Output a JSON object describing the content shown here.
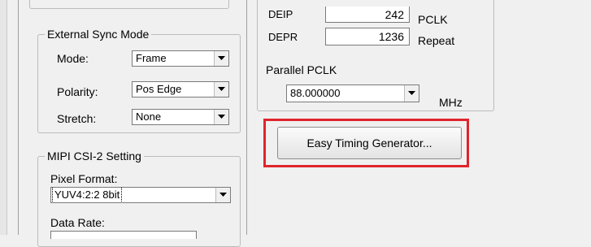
{
  "external_sync": {
    "title": "External Sync Mode",
    "mode_label": "Mode:",
    "mode_value": "Frame",
    "polarity_label": "Polarity:",
    "polarity_value": "Pos Edge",
    "stretch_label": "Stretch:",
    "stretch_value": "None"
  },
  "mipi": {
    "title": "MIPI CSI-2 Setting",
    "pixel_format_label": "Pixel Format:",
    "pixel_format_value": "YUV4:2:2 8bit",
    "data_rate_label": "Data Rate:"
  },
  "timing": {
    "deip_label": "DEIP",
    "deip_value": "242",
    "deip_unit": "PCLK",
    "depr_label": "DEPR",
    "depr_value": "1236",
    "depr_unit": "Repeat"
  },
  "parallel": {
    "label": "Parallel PCLK",
    "value": "88.000000",
    "unit": "MHz"
  },
  "easy_timing_button": "Easy Timing Generator...",
  "colors": {
    "highlight": "#e0242b",
    "background": "#f0f0f0"
  }
}
